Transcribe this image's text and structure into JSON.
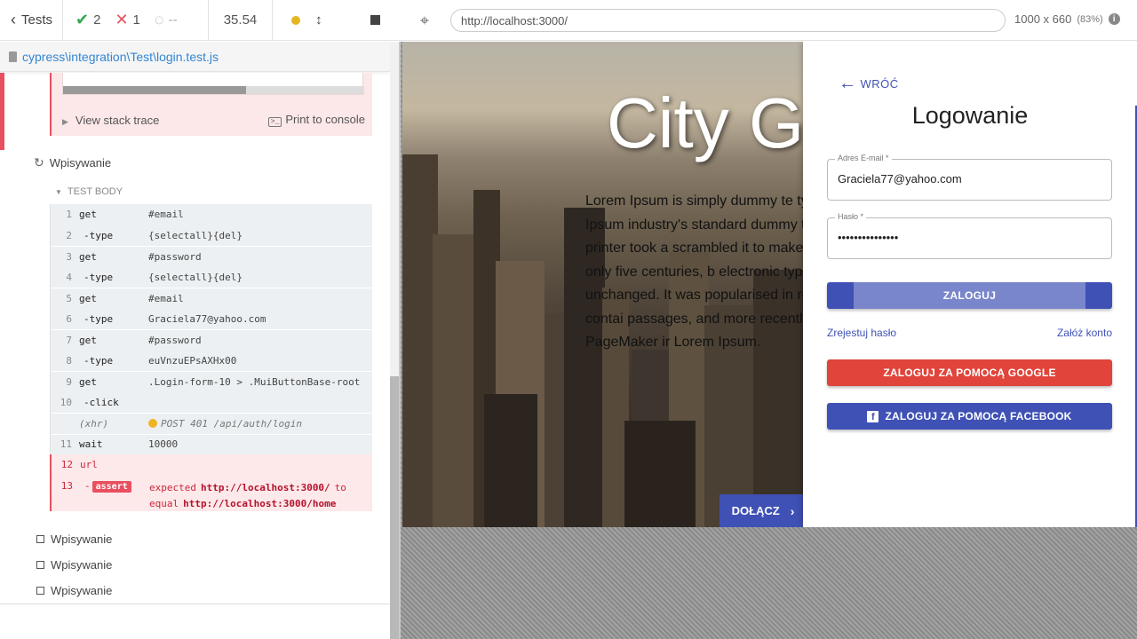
{
  "reporter": {
    "back_label": "Tests",
    "passed": "2",
    "failed": "1",
    "pending": "--",
    "duration": "35.54",
    "spec_path": "cypress\\integration\\Test\\login.test.js",
    "error": {
      "stack_label": "View stack trace",
      "console_label": "Print to console"
    },
    "current_test": "Wpisywanie",
    "section_label": "TEST BODY",
    "commands": [
      {
        "num": "1",
        "name": "get",
        "msg": "#email"
      },
      {
        "num": "2",
        "name": "-type",
        "msg": "{selectall}{del}"
      },
      {
        "num": "3",
        "name": "get",
        "msg": "#password"
      },
      {
        "num": "4",
        "name": "-type",
        "msg": "{selectall}{del}"
      },
      {
        "num": "5",
        "name": "get",
        "msg": "#email"
      },
      {
        "num": "6",
        "name": "-type",
        "msg": "Graciela77@yahoo.com"
      },
      {
        "num": "7",
        "name": "get",
        "msg": "#password"
      },
      {
        "num": "8",
        "name": "-type",
        "msg": "euVnzuEPsAXHx00"
      },
      {
        "num": "9",
        "name": "get",
        "msg": ".Login-form-10 > .MuiButtonBase-root"
      },
      {
        "num": "10",
        "name": "-click",
        "msg": ""
      },
      {
        "num": "",
        "name": "(xhr)",
        "msg": "POST 401 /api/auth/login"
      },
      {
        "num": "11",
        "name": "wait",
        "msg": "10000"
      },
      {
        "num": "12",
        "name": "url",
        "msg": ""
      },
      {
        "num": "13",
        "name": "-",
        "badge": "assert",
        "exp1": "expected",
        "exp_url1": "http://localhost:3000/",
        "exp_to": "to",
        "exp2": "equal",
        "exp_url2": "http://localhost:3000/home"
      }
    ],
    "other_tests": [
      "Wpisywanie",
      "Wpisywanie",
      "Wpisywanie"
    ]
  },
  "aut": {
    "url": "http://localhost:3000/",
    "viewport": "1000 x 660",
    "scale": "(83%)"
  },
  "app": {
    "hero_title": "City Ga",
    "hero_text": "Lorem Ipsum is simply dummy te typesetting industry. Lorem Ipsum industry's standard dummy text e when an unknown printer took a scrambled it to make a type spec survived not only five centuries, b electronic typesetting, remaining unchanged. It was popularised in release of Letraset sheets contai passages, and more recently with software like Aldus PageMaker ir Lorem Ipsum.",
    "join_label": "DOŁĄCZ",
    "login": {
      "back_label": "WRÓĆ",
      "title": "Logowanie",
      "email_label": "Adres E-mail *",
      "email_value": "Graciela77@yahoo.com",
      "password_label": "Hasło *",
      "password_value": "•••••••••••••••",
      "submit_label": "ZALOGUJ",
      "reset_label": "Zrejestuj hasło",
      "register_label": "Załóż konto",
      "google_label": "ZALOGUJ ZA POMOCĄ GOOGLE",
      "facebook_label": "ZALOGUJ ZA POMOCĄ FACEBOOK"
    }
  },
  "colors": {
    "pass": "#32a852",
    "fail": "#e94f5f",
    "primary": "#3f51b5",
    "google": "#e0443a",
    "link": "#3386d4"
  }
}
